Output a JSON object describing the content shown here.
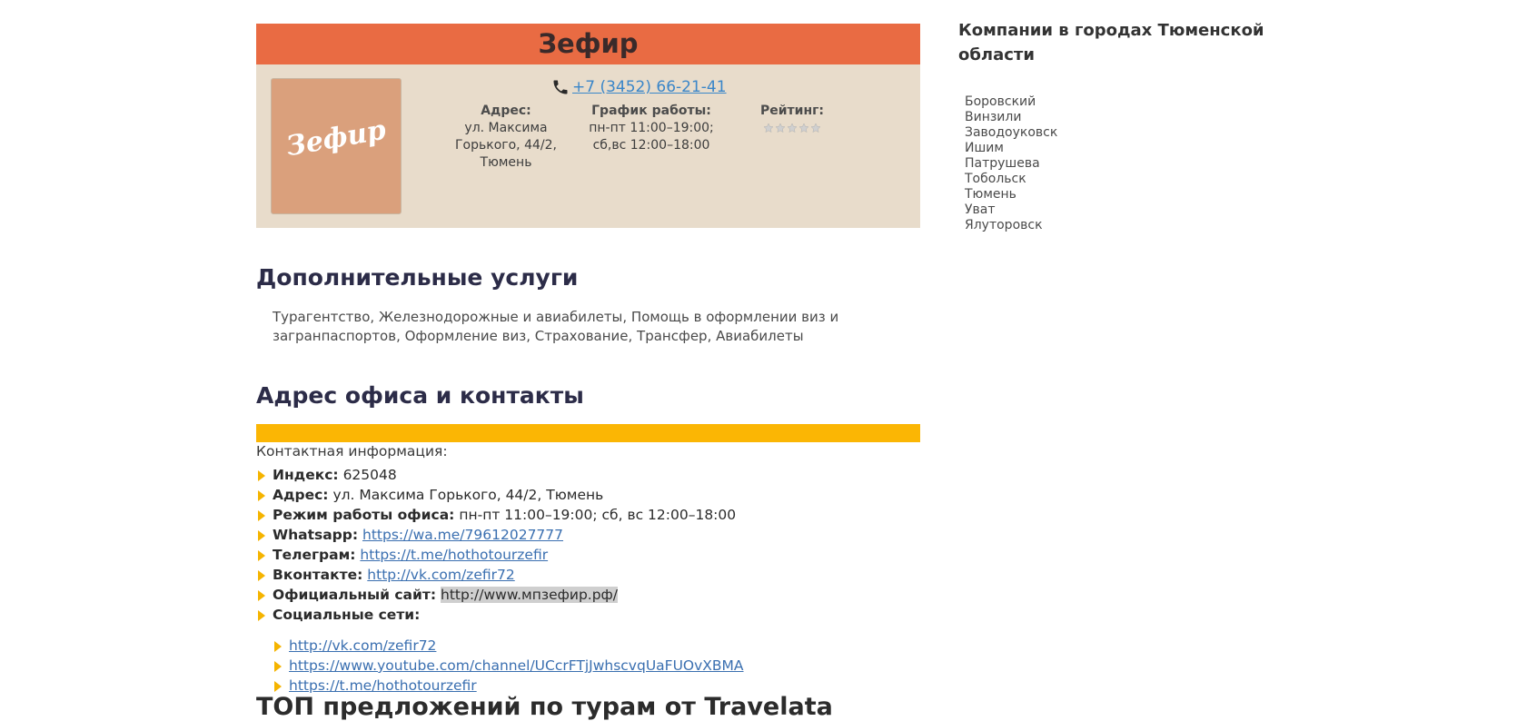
{
  "company": {
    "name": "Зефир",
    "logo_text": "Зефир",
    "phone": "+7 (3452) 66-21-41",
    "address_label": "Адрес:",
    "address_lines": [
      "ул. Максима",
      "Горького, 44/2,",
      "Тюмень"
    ],
    "hours_label": "График работы:",
    "hours_lines": [
      "пн-пт 11:00–19:00;",
      "сб,вс 12:00–18:00"
    ],
    "rating_label": "Рейтинг:",
    "rating_value": 0,
    "rating_max": 5
  },
  "services": {
    "heading": "Дополнительные услуги",
    "text": "Турагентство, Железнодорожные и авиабилеты, Помощь в оформлении виз и загранпаспортов, Оформление виз, Страхование, Трансфер, Авиабилеты"
  },
  "contacts": {
    "heading": "Адрес офиса и контакты",
    "title": "Контактная информация:",
    "index_label": "Индекс:",
    "index_value": "625048",
    "address_label": "Адрес:",
    "address_value": "ул. Максима Горького, 44/2, Тюмень",
    "office_hours_label": "Режим работы офиса:",
    "office_hours_value": "пн-пт 11:00–19:00; сб, вс 12:00–18:00",
    "whatsapp_label": "Whatsapp:",
    "whatsapp_link": "https://wa.me/79612027777",
    "telegram_label": "Телеграм:",
    "telegram_link": "https://t.me/hothotourzefir",
    "vk_label": "Вконтакте:",
    "vk_link": "http://vk.com/zefir72",
    "site_label": "Официальный сайт:",
    "site_value": "http://www.мпзефир.рф/",
    "social_label": "Социальные сети:",
    "social_links": [
      "http://vk.com/zefir72",
      "https://www.youtube.com/channel/UCcrFTjJwhscvqUaFUOvXBMA",
      "https://t.me/hothotourzefir"
    ]
  },
  "bottom_heading": "ТОП предложений по турам от Travelata",
  "sidebar": {
    "title": "Компании в городах Тюменской области",
    "cities": [
      "Боровский",
      "Винзили",
      "Заводоуковск",
      "Ишим",
      "Патрушева",
      "Тобольск",
      "Тюмень",
      "Уват",
      "Ялуторовск"
    ]
  },
  "colors": {
    "card_header": "#e96b43",
    "card_body": "#e8dccb",
    "accent_bar": "#fbb604",
    "bullet": "#f5b400",
    "link": "#3a6fb0"
  }
}
